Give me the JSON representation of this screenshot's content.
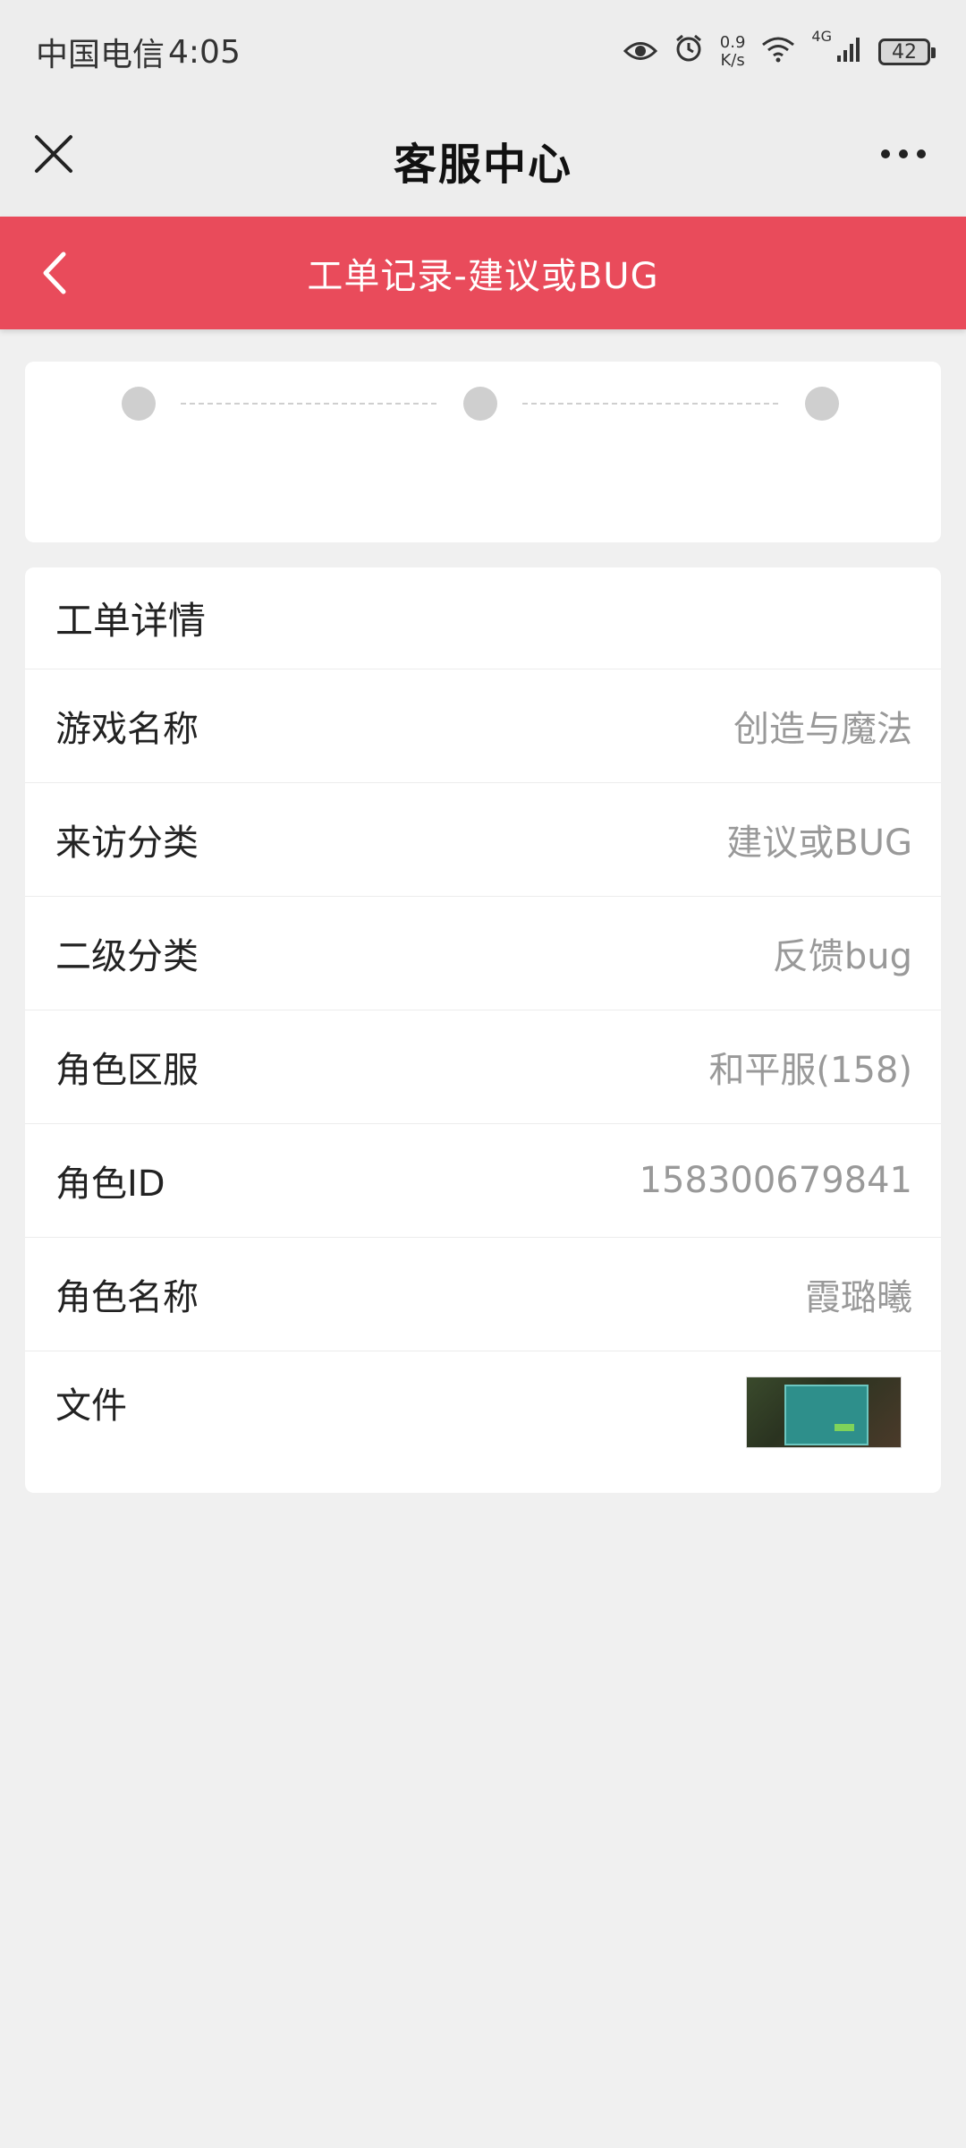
{
  "status_bar": {
    "carrier": "中国电信",
    "time": "4:05",
    "net_speed_value": "0.9",
    "net_speed_unit": "K/s",
    "network_type": "4G",
    "battery": "42"
  },
  "title_bar": {
    "title": "客服中心"
  },
  "header": {
    "title": "工单记录-建议或BUG"
  },
  "details": {
    "section_title": "工单详情",
    "rows": [
      {
        "label": "游戏名称",
        "value": "创造与魔法"
      },
      {
        "label": "来访分类",
        "value": "建议或BUG"
      },
      {
        "label": "二级分类",
        "value": "反馈bug"
      },
      {
        "label": "角色区服",
        "value": "和平服(158)"
      },
      {
        "label": "角色ID",
        "value": "158300679841"
      },
      {
        "label": "角色名称",
        "value": "霞璐曦"
      }
    ],
    "file_label": "文件"
  }
}
